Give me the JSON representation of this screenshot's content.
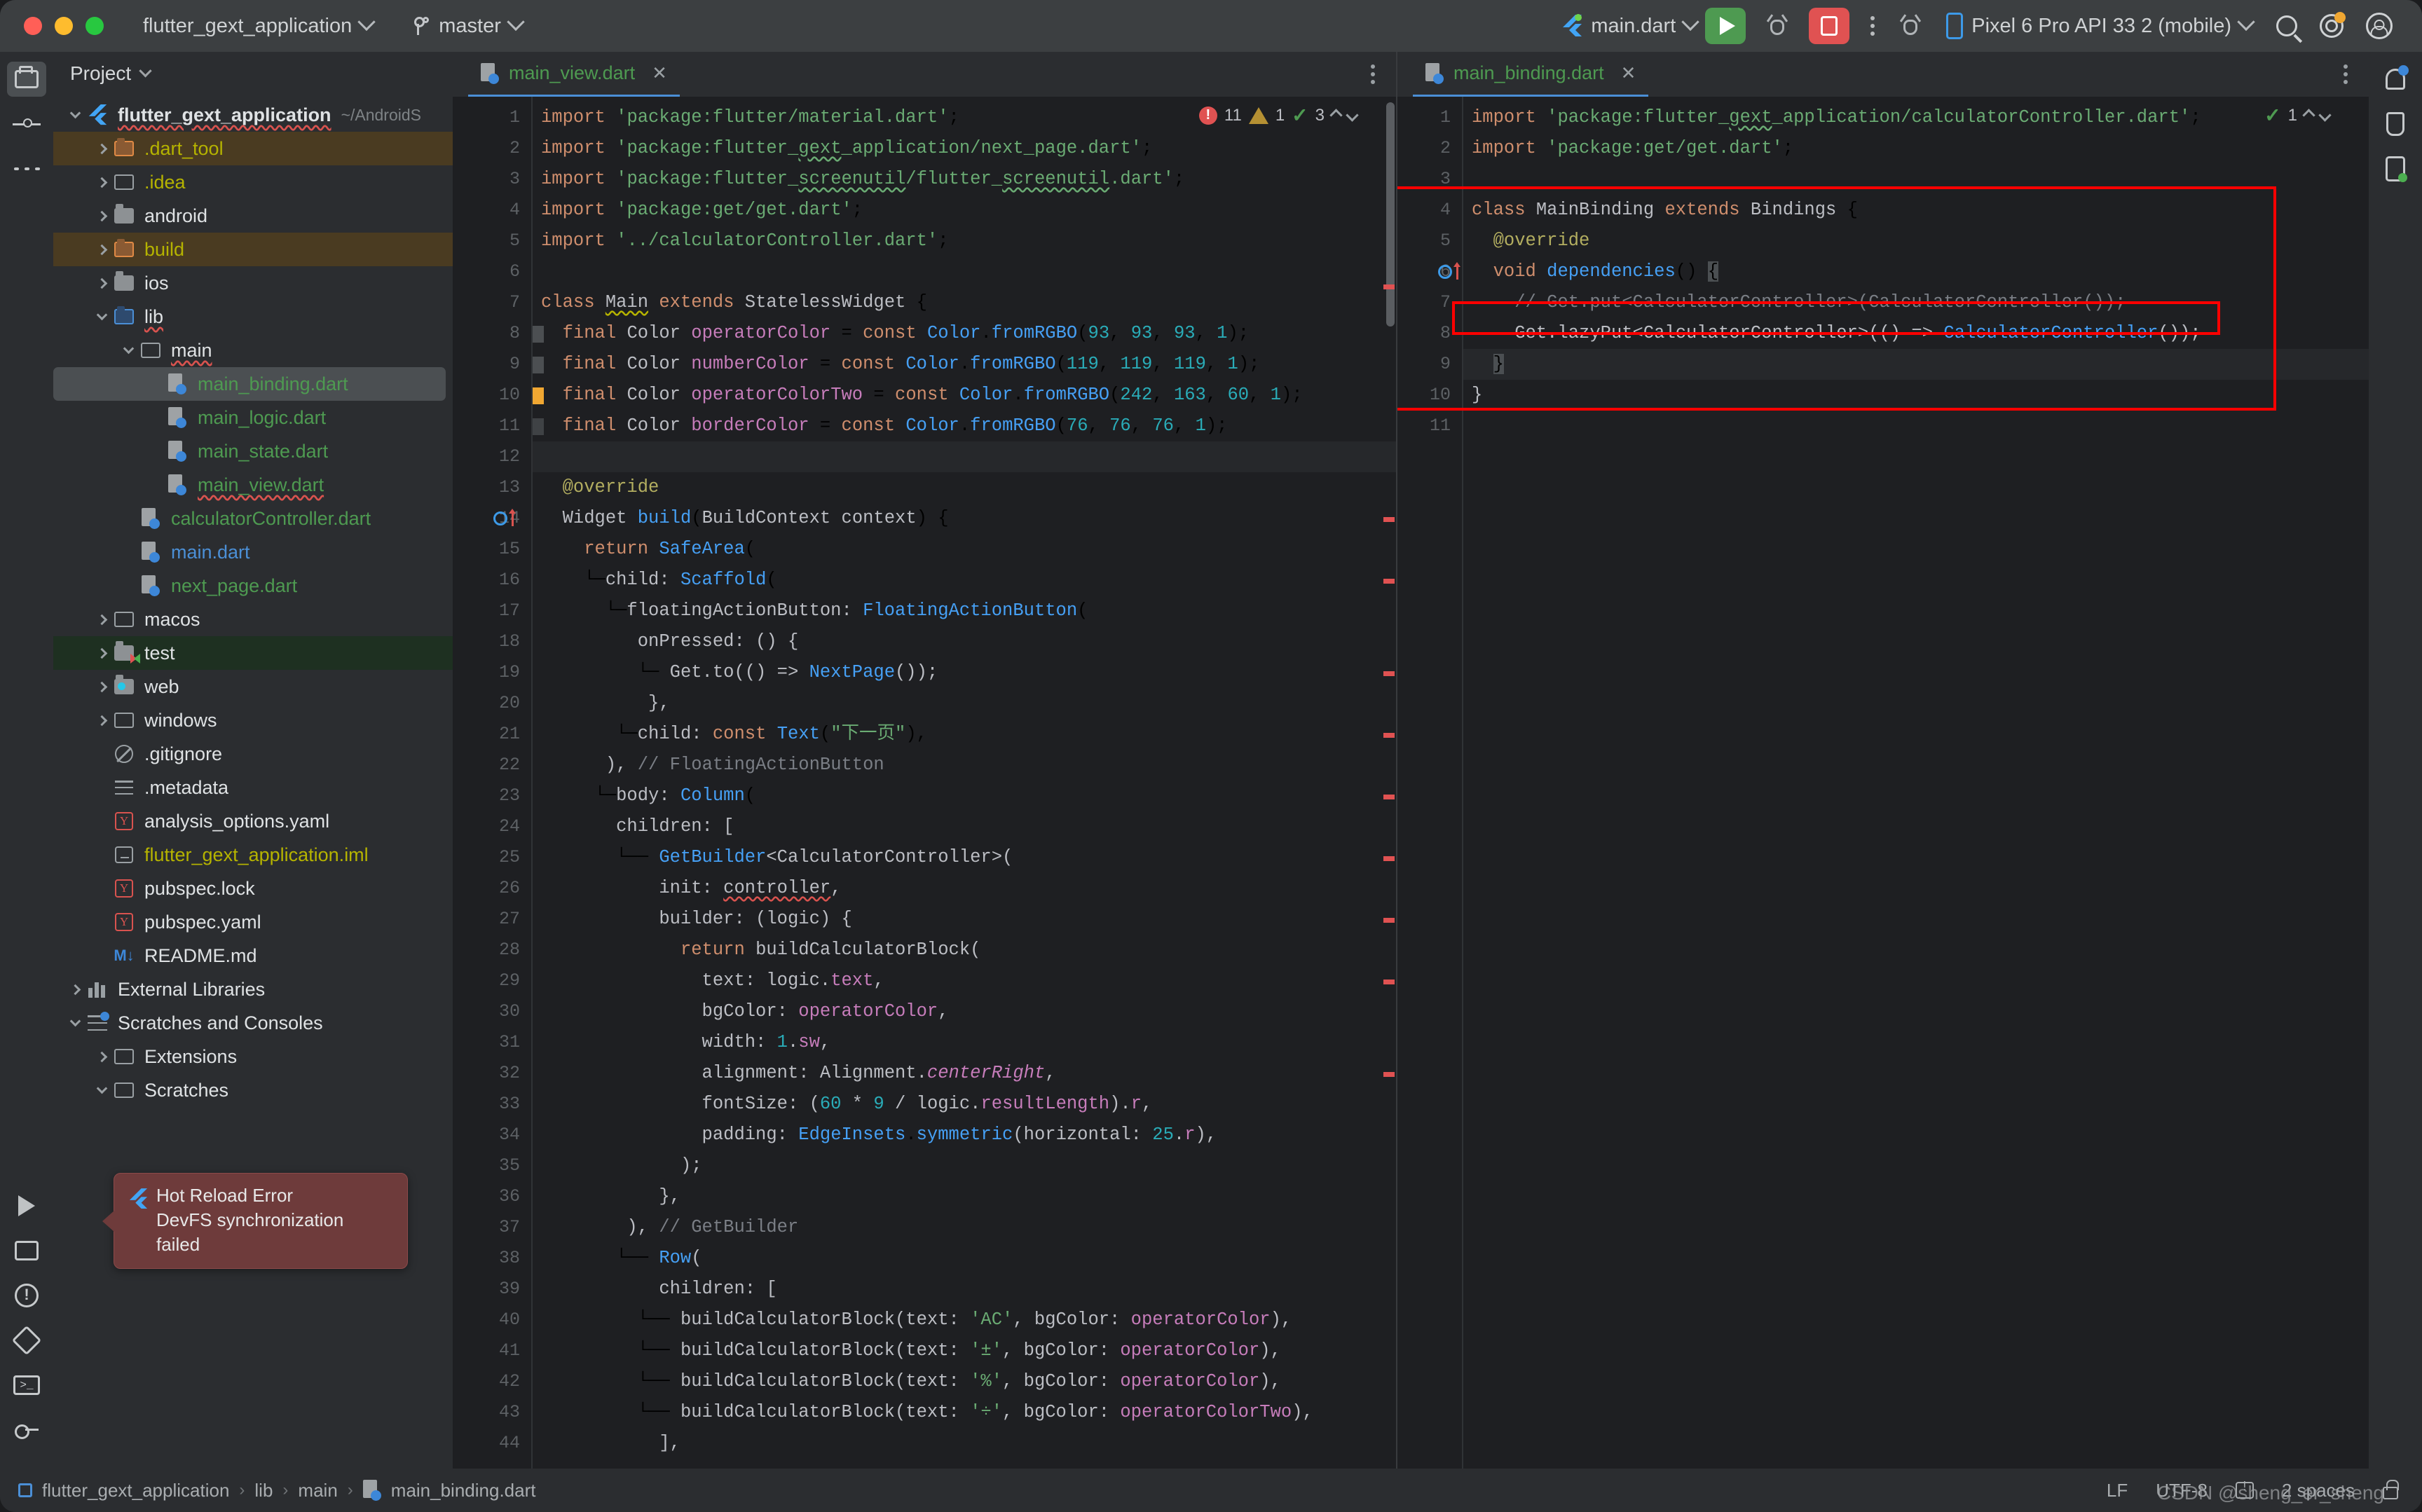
{
  "titlebar": {
    "project_name": "flutter_gext_application",
    "branch": "master",
    "run_config": "main.dart",
    "device": "Pixel 6 Pro API 33 2 (mobile)",
    "icons": {
      "run": "run-icon",
      "debug": "debug-icon",
      "stop": "stop-icon",
      "more": "more-options-icon",
      "profile": "run-with-profiler-icon",
      "search": "search-icon",
      "settings": "settings-gear-icon",
      "account": "account-avatar-icon"
    }
  },
  "left_rail": {
    "items": [
      {
        "name": "project-tool-window",
        "icon": "folder-icon",
        "active": true
      },
      {
        "name": "commit-tool-window",
        "icon": "commit-icon",
        "active": false
      },
      {
        "name": "more-tool-windows",
        "icon": "more-dots-icon",
        "active": false
      }
    ],
    "bottom_items": [
      {
        "name": "run-tool-window",
        "icon": "play-icon"
      },
      {
        "name": "build-tool-window",
        "icon": "build-icon"
      },
      {
        "name": "problems-tool-window",
        "icon": "warning-icon"
      },
      {
        "name": "flutter-inspector-tool-window",
        "icon": "diamond-icon"
      },
      {
        "name": "terminal-tool-window",
        "icon": "terminal-icon"
      },
      {
        "name": "services-tool-window",
        "icon": "key-icon"
      }
    ]
  },
  "right_rail": {
    "items": [
      {
        "name": "notifications",
        "icon": "bell-icon"
      },
      {
        "name": "flutter-outline",
        "icon": "flask-icon"
      },
      {
        "name": "device-manager",
        "icon": "device-icon"
      }
    ]
  },
  "project_panel": {
    "title": "Project",
    "tree": [
      {
        "label": "flutter_gext_application",
        "suffix": "~/AndroidS",
        "icon": "flutter-icon",
        "indent": 0,
        "arrow": "down",
        "color": "white",
        "bold": true,
        "wave": true
      },
      {
        "label": ".dart_tool",
        "icon": "folder-orange-icon",
        "indent": 1,
        "arrow": "right",
        "color": "yellow",
        "highlight": "brown"
      },
      {
        "label": ".idea",
        "icon": "folder-excluded-icon",
        "indent": 1,
        "arrow": "right",
        "color": "yellow"
      },
      {
        "label": "android",
        "icon": "folder-module-icon",
        "indent": 1,
        "arrow": "right",
        "color": "white"
      },
      {
        "label": "build",
        "icon": "folder-orange-icon",
        "indent": 1,
        "arrow": "right",
        "color": "yellow",
        "highlight": "brown"
      },
      {
        "label": "ios",
        "icon": "folder-module-icon",
        "indent": 1,
        "arrow": "right",
        "color": "white"
      },
      {
        "label": "lib",
        "icon": "folder-source-icon",
        "indent": 1,
        "arrow": "down",
        "color": "white",
        "wave": true
      },
      {
        "label": "main",
        "icon": "folder-icon",
        "indent": 2,
        "arrow": "down",
        "color": "white",
        "wave": true
      },
      {
        "label": "main_binding.dart",
        "icon": "dart-file-icon",
        "indent": 3,
        "arrow": "none",
        "color": "green",
        "highlight": "selected"
      },
      {
        "label": "main_logic.dart",
        "icon": "dart-file-icon",
        "indent": 3,
        "arrow": "none",
        "color": "green"
      },
      {
        "label": "main_state.dart",
        "icon": "dart-file-icon",
        "indent": 3,
        "arrow": "none",
        "color": "green"
      },
      {
        "label": "main_view.dart",
        "icon": "dart-file-icon",
        "indent": 3,
        "arrow": "none",
        "color": "green",
        "wave": true
      },
      {
        "label": "calculatorController.dart",
        "icon": "dart-file-icon",
        "indent": 2,
        "arrow": "none",
        "color": "green"
      },
      {
        "label": "main.dart",
        "icon": "dart-file-icon",
        "indent": 2,
        "arrow": "none",
        "color": "blue"
      },
      {
        "label": "next_page.dart",
        "icon": "dart-file-icon",
        "indent": 2,
        "arrow": "none",
        "color": "green"
      },
      {
        "label": "macos",
        "icon": "folder-icon",
        "indent": 1,
        "arrow": "right",
        "color": "white"
      },
      {
        "label": "test",
        "icon": "folder-test-icon",
        "indent": 1,
        "arrow": "right",
        "color": "white",
        "highlight": "green"
      },
      {
        "label": "web",
        "icon": "folder-web-icon",
        "indent": 1,
        "arrow": "right",
        "color": "white"
      },
      {
        "label": "windows",
        "icon": "folder-icon",
        "indent": 1,
        "arrow": "right",
        "color": "white"
      },
      {
        "label": ".gitignore",
        "icon": "gitignore-icon",
        "indent": 1,
        "arrow": "none",
        "color": "white"
      },
      {
        "label": ".metadata",
        "icon": "text-file-icon",
        "indent": 1,
        "arrow": "none",
        "color": "white"
      },
      {
        "label": "analysis_options.yaml",
        "icon": "yaml-file-icon",
        "indent": 1,
        "arrow": "none",
        "color": "white"
      },
      {
        "label": "flutter_gext_application.iml",
        "icon": "iml-file-icon",
        "indent": 1,
        "arrow": "none",
        "color": "yellow"
      },
      {
        "label": "pubspec.lock",
        "icon": "yaml-file-icon",
        "indent": 1,
        "arrow": "none",
        "color": "white"
      },
      {
        "label": "pubspec.yaml",
        "icon": "yaml-file-icon",
        "indent": 1,
        "arrow": "none",
        "color": "white"
      },
      {
        "label": "README.md",
        "icon": "markdown-file-icon",
        "indent": 1,
        "arrow": "none",
        "color": "white"
      },
      {
        "label": "External Libraries",
        "icon": "libraries-icon",
        "indent": 0,
        "arrow": "right",
        "color": "white"
      },
      {
        "label": "Scratches and Consoles",
        "icon": "scratches-icon",
        "indent": 0,
        "arrow": "down",
        "color": "white"
      },
      {
        "label": "Extensions",
        "icon": "folder-icon",
        "indent": 1,
        "arrow": "right",
        "color": "white"
      },
      {
        "label": "Scratches",
        "icon": "folder-icon",
        "indent": 1,
        "arrow": "down",
        "color": "white"
      }
    ]
  },
  "tooltip": {
    "title": "Hot Reload Error",
    "message": "DevFS synchronization failed"
  },
  "editor_left": {
    "tab": "main_view.dart",
    "inspection": {
      "errors": "11",
      "warnings": "1",
      "ok": "3"
    },
    "lines": [
      {
        "n": 1,
        "html": "<span class='kw'>import</span> <span class='str'>'package:flutter/material.dart'</span>;"
      },
      {
        "n": 2,
        "html": "<span class='kw'>import</span> <span class='str'>'package:flutter_<span class='wavg'>gext</span>_application/next_page.dart'</span>;"
      },
      {
        "n": 3,
        "html": "<span class='kw'>import</span> <span class='str'>'package:flutter_<span class='wavg'>screenutil</span>/flutter_<span class='wavg'>screenutil</span>.dart'</span>;"
      },
      {
        "n": 4,
        "html": "<span class='kw'>import</span> <span class='str'>'package:get/get.dart'</span>;"
      },
      {
        "n": 5,
        "html": "<span class='kw'>import</span> <span class='str'>'../calculatorController.dart'</span>;"
      },
      {
        "n": 6,
        "html": ""
      },
      {
        "n": 7,
        "html": "<span class='kw'>class</span> <span class='txt wavy'>Main</span> <span class='kw'>extends</span> <span class='txt'>StatelessWidget</span> {"
      },
      {
        "n": 8,
        "html": "  <span class='kw'>final</span> <span class='txt'>Color</span> <span class='fld2'>operatorColor</span> = <span class='kw'>const</span> <span class='typ'>Color</span>.<span class='typ'>fromRGBO</span>(<span class='num'>93</span>, <span class='num'>93</span>, <span class='num'>93</span>, <span class='num'>1</span>);",
        "mark": "gray"
      },
      {
        "n": 9,
        "html": "  <span class='kw'>final</span> <span class='txt'>Color</span> <span class='fld2'>numberColor</span> = <span class='kw'>const</span> <span class='typ'>Color</span>.<span class='typ'>fromRGBO</span>(<span class='num'>119</span>, <span class='num'>119</span>, <span class='num'>119</span>, <span class='num'>1</span>);",
        "mark": "gray"
      },
      {
        "n": 10,
        "html": "  <span class='kw'>final</span> <span class='txt'>Color</span> <span class='fld2'>operatorColorTwo</span> = <span class='kw'>const</span> <span class='typ'>Color</span>.<span class='typ'>fromRGBO</span>(<span class='num'>242</span>, <span class='num'>163</span>, <span class='num'>60</span>, <span class='num'>1</span>);",
        "mark": "orange"
      },
      {
        "n": 11,
        "html": "  <span class='kw'>final</span> <span class='txt'>Color</span> <span class='fld2'>borderColor</span> = <span class='kw'>const</span> <span class='typ'>Color</span>.<span class='typ'>fromRGBO</span>(<span class='num'>76</span>, <span class='num'>76</span>, <span class='num'>76</span>, <span class='num'>1</span>);",
        "mark": "darkgray"
      },
      {
        "n": 12,
        "html": "",
        "current": true
      },
      {
        "n": 13,
        "html": "  <span class='ann'>@override</span>"
      },
      {
        "n": 14,
        "html": "  <span class='txt'>Widget</span> <span class='typ'>build</span>(<span class='txt'>BuildContext context</span>) {"
      },
      {
        "n": 15,
        "html": "    <span class='kw'>return</span> <span class='typ'>SafeArea</span>("
      },
      {
        "n": 16,
        "html": "    └─<span class='txt'>child: </span><span class='typ'>Scaffold</span>("
      },
      {
        "n": 17,
        "html": "      └─<span class='txt'>floatingActionButton: </span><span class='typ'>FloatingActionButton</span>("
      },
      {
        "n": 18,
        "html": "         <span class='txt'>onPressed: () {</span>"
      },
      {
        "n": 19,
        "html": "         └─ <span class='txt'>Get.to(() =&gt; </span><span class='typ'>NextPage</span><span class='txt'>());</span>"
      },
      {
        "n": 20,
        "html": "          <span class='txt'>},</span>"
      },
      {
        "n": 21,
        "html": "       └─<span class='txt'>child: </span><span class='kw'>const</span> <span class='typ'>Text</span>(<span class='str'>\"下一页\"</span>),"
      },
      {
        "n": 22,
        "html": "      <span class='txt'>), </span><span class='cmt'>// FloatingActionButton</span>"
      },
      {
        "n": 23,
        "html": "     └─<span class='txt'>body: </span><span class='typ'>Column</span>("
      },
      {
        "n": 24,
        "html": "       <span class='txt'>children: [</span>"
      },
      {
        "n": 25,
        "html": "       └── <span class='typ'>GetBuilder</span><span class='txt'>&lt;CalculatorController&gt;(</span>"
      },
      {
        "n": 26,
        "html": "           <span class='txt'>init: </span><span class='txt wav'>controller</span><span class='txt'>,</span>"
      },
      {
        "n": 27,
        "html": "           <span class='txt'>builder: (logic) {</span>"
      },
      {
        "n": 28,
        "html": "             <span class='kw'>return</span> <span class='txt'>buildCalculatorBlock(</span>"
      },
      {
        "n": 29,
        "html": "               <span class='txt'>text: logic.</span><span class='fld2'>text</span><span class='txt'>,</span>"
      },
      {
        "n": 30,
        "html": "               <span class='txt'>bgColor: </span><span class='fld2'>operatorColor</span><span class='txt'>,</span>"
      },
      {
        "n": 31,
        "html": "               <span class='txt'>width: </span><span class='num'>1</span><span class='txt'>.</span><span class='fld2'>sw</span><span class='txt'>,</span>"
      },
      {
        "n": 32,
        "html": "               <span class='txt'>alignment: Alignment.</span><span class='itl'>centerRight</span><span class='txt'>,</span>"
      },
      {
        "n": 33,
        "html": "               <span class='txt'>fontSize: (</span><span class='num'>60</span> <span class='txt'>* </span><span class='num'>9</span> <span class='txt'>/ logic.</span><span class='fld2'>resultLength</span><span class='txt'>).</span><span class='fld2'>r</span><span class='txt'>,</span>"
      },
      {
        "n": 34,
        "html": "               <span class='txt'>padding: </span><span class='typ'>EdgeInsets</span>.<span class='typ'>symmetric</span><span class='txt'>(horizontal: </span><span class='num'>25</span><span class='txt'>.</span><span class='fld2'>r</span><span class='txt'>),</span>"
      },
      {
        "n": 35,
        "html": "             <span class='txt'>);</span>"
      },
      {
        "n": 36,
        "html": "           <span class='txt'>},</span>"
      },
      {
        "n": 37,
        "html": "        <span class='txt'>), </span><span class='cmt'>// GetBuilder</span>"
      },
      {
        "n": 38,
        "html": "       └── <span class='typ'>Row</span><span class='txt'>(</span>"
      },
      {
        "n": 39,
        "html": "           <span class='txt'>children: [</span>"
      },
      {
        "n": 40,
        "html": "         └── <span class='txt'>buildCalculatorBlock(text: </span><span class='str'>'AC'</span><span class='txt'>, bgColor: </span><span class='fld2'>operatorColor</span><span class='txt'>),</span>"
      },
      {
        "n": 41,
        "html": "         └── <span class='txt'>buildCalculatorBlock(text: </span><span class='str'>'±'</span><span class='txt'>, bgColor: </span><span class='fld2'>operatorColor</span><span class='txt'>),</span>"
      },
      {
        "n": 42,
        "html": "         └── <span class='txt'>buildCalculatorBlock(text: </span><span class='str'>'%'</span><span class='txt'>, bgColor: </span><span class='fld2'>operatorColor</span><span class='txt'>),</span>"
      },
      {
        "n": 43,
        "html": "         └── <span class='txt'>buildCalculatorBlock(text: </span><span class='str'>'÷'</span><span class='txt'>, bgColor: </span><span class='fld2'>operatorColorTwo</span><span class='txt'>),</span>"
      },
      {
        "n": 44,
        "html": "           <span class='txt'>],</span>"
      }
    ]
  },
  "editor_right": {
    "tab": "main_binding.dart",
    "inspection": {
      "ok": "1"
    },
    "lines": [
      {
        "n": 1,
        "html": "<span class='kw'>import</span> <span class='str'>'package:flutter_<span class='wavg'>gext</span>_application/calculatorController.dart'</span>;"
      },
      {
        "n": 2,
        "html": "<span class='kw'>import</span> <span class='str'>'package:get/get.dart'</span>;"
      },
      {
        "n": 3,
        "html": ""
      },
      {
        "n": 4,
        "html": "<span class='kw'>class</span> <span class='txt'>MainBinding</span> <span class='kw'>extends</span> <span class='txt'>Bindings</span> {"
      },
      {
        "n": 5,
        "html": "  <span class='ann'>@override</span>"
      },
      {
        "n": 6,
        "html": "  <span class='kw'>void</span> <span class='typ'>dependencies</span>() <span class='cursorbg'>{</span>"
      },
      {
        "n": 7,
        "html": "    <span class='cmt'>// Get.put&lt;CalculatorController&gt;(CalculatorController());</span>"
      },
      {
        "n": 8,
        "html": "    <span class='txt'>Get.lazyPut&lt;CalculatorController&gt;(() =&gt; </span><span class='typ'>CalculatorController</span><span class='txt'>());</span>"
      },
      {
        "n": 9,
        "html": "  <span class='cursorbg'>}</span>",
        "current": true
      },
      {
        "n": 10,
        "html": "<span class='txt'>}</span>"
      },
      {
        "n": 11,
        "html": ""
      }
    ]
  },
  "statusbar": {
    "breadcrumbs": [
      "flutter_gext_application",
      "lib",
      "main",
      "main_binding.dart"
    ],
    "line_separator": "LF",
    "encoding": "UTF-8",
    "indent": "2 spaces",
    "watermark": "CSDN @sheng_er_sheng"
  }
}
